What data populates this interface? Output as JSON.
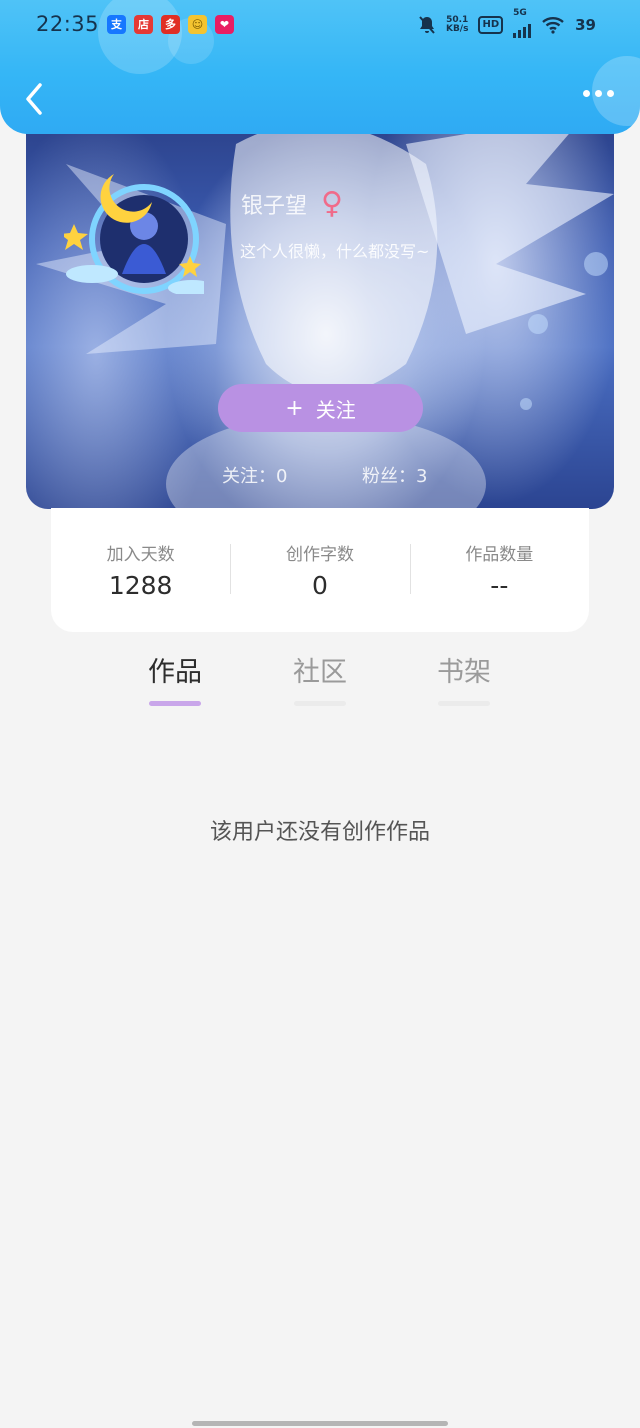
{
  "status_bar": {
    "time": "22:35",
    "apps": [
      {
        "icon": "alipay-icon",
        "glyph": "支",
        "color": "#1677ff"
      },
      {
        "icon": "shop-icon",
        "glyph": "店",
        "color": "#e53935"
      },
      {
        "icon": "pdd-icon",
        "glyph": "多",
        "color": "#e02e24"
      },
      {
        "icon": "chat-icon",
        "glyph": "☺",
        "color": "#f4c430"
      },
      {
        "icon": "heart-app-icon",
        "glyph": "❤",
        "color": "#e91e63"
      }
    ],
    "net_speed_value": "50.1",
    "net_speed_unit": "KB/s",
    "hd_label": "HD",
    "network_label": "5G",
    "battery": "39"
  },
  "profile": {
    "username": "银子望",
    "gender_symbol": "♀",
    "bio": "这个人很懒，什么都没写~",
    "follow_button_plus": "+",
    "follow_button_label": "关注",
    "following_label": "关注：0",
    "followers_label": "粉丝：3",
    "colors": {
      "accent": "#b991e3",
      "header": "#35b6f6",
      "gender": "#f06b8a"
    }
  },
  "stats": [
    {
      "label": "加入天数",
      "value": "1288"
    },
    {
      "label": "创作字数",
      "value": "0"
    },
    {
      "label": "作品数量",
      "value": "--"
    }
  ],
  "tabs": [
    {
      "label": "作品",
      "active": true
    },
    {
      "label": "社区",
      "active": false
    },
    {
      "label": "书架",
      "active": false
    }
  ],
  "empty_state": "该用户还没有创作作品"
}
